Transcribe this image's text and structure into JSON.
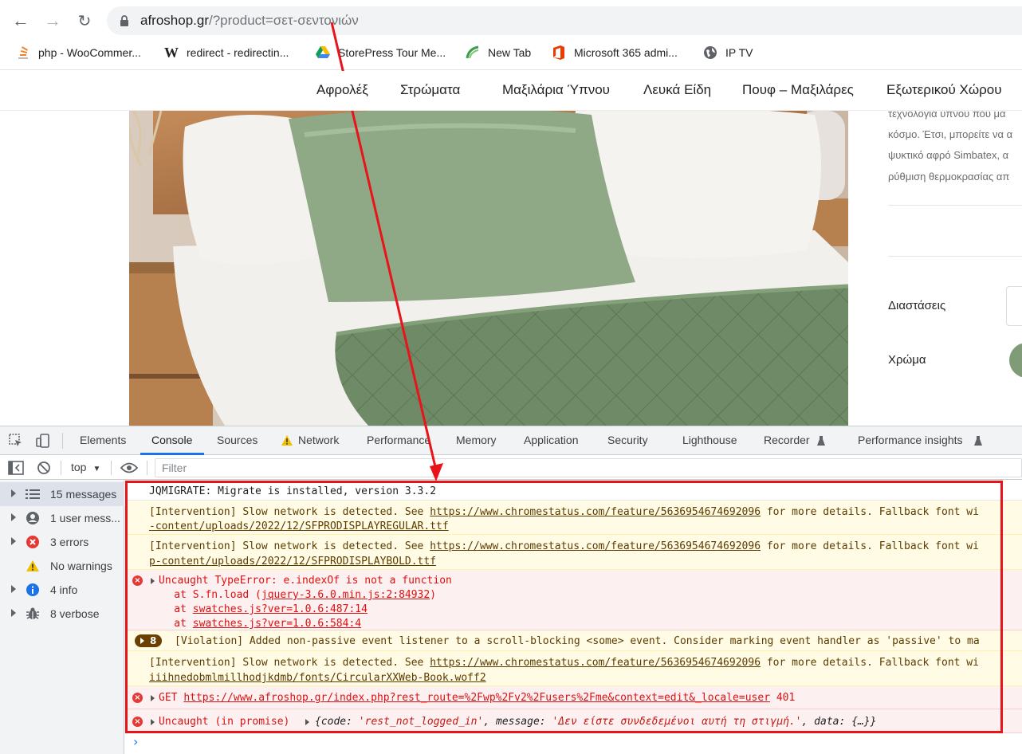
{
  "browser": {
    "url_host": "afroshop.gr",
    "url_path": "/?product=σετ-σεντονιών",
    "bookmarks": [
      {
        "icon": "stack-overflow-icon",
        "label": "php - WooCommer..."
      },
      {
        "icon": "wikipedia-icon",
        "label": "redirect - redirectin..."
      },
      {
        "icon": "google-drive-icon",
        "label": "StorePress Tour Me..."
      },
      {
        "icon": "new-tab-icon",
        "label": "New Tab"
      },
      {
        "icon": "office-icon",
        "label": "Microsoft 365 admi..."
      },
      {
        "icon": "globe-icon",
        "label": "IP TV"
      }
    ]
  },
  "site": {
    "menu": [
      "Αφρολέξ",
      "Στρώματα",
      "Μαξιλάρια Ύπνου",
      "Λευκά Είδη",
      "Πουφ – Μαξιλάρες",
      "Εξωτερικού Χώρου"
    ],
    "description_lines": [
      "τεχνολογία ύπνου που μα",
      "κόσμο. Έτσι, μπορείτε να α",
      "ψυκτικό αφρό Simbatex, α",
      "ρύθμιση θερμοκρασίας απ"
    ],
    "attributes": {
      "dimensions_label": "Διαστάσεις",
      "color_label": "Χρώμα"
    },
    "colors": {
      "swatch": "#7f9b78"
    }
  },
  "devtools": {
    "tabs": [
      "Elements",
      "Console",
      "Sources",
      "Network",
      "Performance",
      "Memory",
      "Application",
      "Security",
      "Lighthouse",
      "Recorder",
      "Performance insights"
    ],
    "active_tab": "Console",
    "context": "top",
    "filter_placeholder": "Filter",
    "sidebar": [
      {
        "icon": "list-icon",
        "label": "15 messages"
      },
      {
        "icon": "user-icon",
        "label": "1 user mess..."
      },
      {
        "icon": "error-icon",
        "label": "3 errors"
      },
      {
        "icon": "warning-icon",
        "label": "No warnings"
      },
      {
        "icon": "info-icon",
        "label": "4 info"
      },
      {
        "icon": "bug-icon",
        "label": "8 verbose"
      }
    ],
    "console": {
      "m1": "JQMIGRATE: Migrate is installed, version 3.3.2",
      "m2a_pre": "[Intervention] Slow network is detected. See ",
      "m2a_link": "https://www.chromestatus.com/feature/5636954674692096",
      "m2a_post": " for more details. Fallback font wi",
      "m2b": "-content/uploads/2022/12/SFPRODISPLAYREGULAR.ttf",
      "m3a_pre": "[Intervention] Slow network is detected. See ",
      "m3a_link": "https://www.chromestatus.com/feature/5636954674692096",
      "m3a_post": " for more details. Fallback font wi",
      "m3b": "p-content/uploads/2022/12/SFPRODISPLAYBOLD.ttf",
      "m4a": "Uncaught TypeError: e.indexOf is not a function",
      "m4b_pre": "    at S.fn.load (",
      "m4b_link": "jquery-3.6.0.min.js:2:84932",
      "m4b_post": ")",
      "m4c_pre": "    at ",
      "m4c_link": "swatches.js?ver=1.0.6:487:14",
      "m4d_pre": "    at ",
      "m4d_link": "swatches.js?ver=1.0.6:584:4",
      "m5_count": "8",
      "m5": "[Violation] Added non-passive event listener to a scroll-blocking <some> event. Consider marking event handler as 'passive' to ma",
      "m6a_pre": "[Intervention] Slow network is detected. See ",
      "m6a_link": "https://www.chromestatus.com/feature/5636954674692096",
      "m6a_post": " for more details. Fallback font wi",
      "m6b": "iiihnedobmlmillhodjkdmb/fonts/CircularXXWeb-Book.woff2",
      "m7_pre": "GET ",
      "m7_link": "https://www.afroshop.gr/index.php?rest_route=%2Fwp%2Fv2%2Fusers%2Fme&context=edit&_locale=user",
      "m7_code": " 401",
      "m8_pre": "Uncaught (in promise) ",
      "m8_obj_open": "{code: ",
      "m8_code": "'rest_not_logged_in'",
      "m8_mid": ", message: ",
      "m8_msg": "'Δεν είστε συνδεδεμένοι αυτή τη στιγμή.'",
      "m8_end": ", data: {…}}",
      "prompt": "›"
    }
  },
  "annotation": {
    "color": "#e8141a"
  }
}
